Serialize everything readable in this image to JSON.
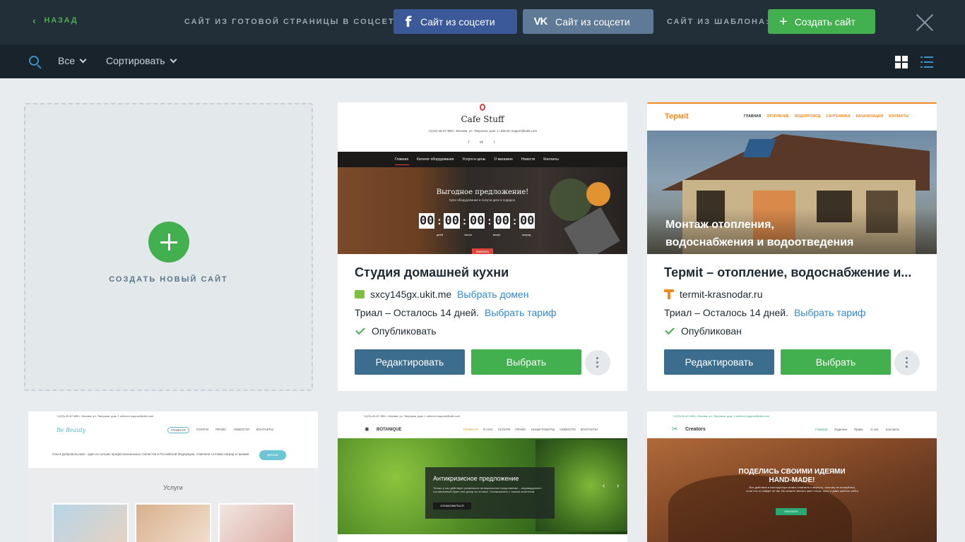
{
  "topbar": {
    "back_label": "НАЗАД",
    "social_label": "САЙТ ИЗ ГОТОВОЙ СТРАНИЦЫ В СОЦСЕТИ:",
    "fb_button": "Сайт из соцсети",
    "vk_button": "Сайт из соцсети",
    "template_label": "САЙТ ИЗ ШАБЛОНА:",
    "create_button": "Создать сайт"
  },
  "filterbar": {
    "filter_all": "Все",
    "sort_label": "Сортировать"
  },
  "new_site": {
    "label": "СОЗДАТЬ НОВЫЙ САЙТ"
  },
  "cards": [
    {
      "title": "Студия домашней кухни",
      "domain": "sxcy145gx.ukit.me",
      "domain_action": "Выбрать домен",
      "trial": "Триал – Осталось 14 дней.",
      "tariff_action": "Выбрать тариф",
      "status": "Опубликовать",
      "edit_button": "Редактировать",
      "select_button": "Выбрать",
      "preview": {
        "brand": "Cafe Stuff",
        "contacts": "+1(23)-45-67-890   г. Москва, ул. Тверская, дом. 1   ukitcom   support@ukit.com",
        "socials": [
          "f",
          "vk",
          "t"
        ],
        "nav": [
          "Главная",
          "Каталог оборудования",
          "Услуги и цены",
          "О магазине",
          "Новости",
          "Контакты"
        ],
        "headline": "Выгодное предложение!",
        "subline": "Купи оборудование и получи диск в подарок.",
        "countdown": [
          "00",
          "00",
          "00",
          "00",
          "00"
        ],
        "countdown_labels": [
          "дней",
          "часов",
          "минут",
          "секунд"
        ],
        "cta": "Заказать"
      }
    },
    {
      "title": "Термit – отопление, водоснабжение и...",
      "domain": "termit-krasnodar.ru",
      "trial": "Триал – Осталось 14 дней.",
      "tariff_action": "Выбрать тариф",
      "status": "Опубликован",
      "edit_button": "Редактировать",
      "select_button": "Выбрать",
      "preview": {
        "brand": "Термit",
        "nav": [
          "ГЛАВНАЯ",
          "ОТОПЛЕНИЕ",
          "ВОДОПРОВОД",
          "САНТЕХНИКА",
          "КАНАЛИЗАЦИЯ",
          "КОНТАКТЫ"
        ],
        "headline_1": "Монтаж отопления,",
        "headline_2": "водоснабжения и водоотведения"
      }
    },
    {
      "preview": {
        "contacts": "+1(23)-45-67-890   г. Москва, ул. Тверская, дом. 1   ukitcom   support@ukit.com",
        "brand": "Be Beauty",
        "nav": [
          "ГЛАВНАЯ",
          "УСЛУГИ",
          "ПРАЙС",
          "НОВОСТИ",
          "КОНТАКТЫ"
        ],
        "intro": "Ольга Добровольская - один из лучших профессиональных стилистов в Российской Федерации, отмечена сотнями наград и премий.",
        "button": "Детали",
        "section_title": "Услуги"
      }
    },
    {
      "preview": {
        "contacts": "+1(23)-45-67-890   г. Москва, ул. Тверская, дом. 1   ukitcom   support@ukit.com",
        "brand": "BOTANIQUE",
        "nav": [
          "ГЛАВНАЯ",
          "О НАС",
          "УСЛУГИ",
          "ПРАЙС",
          "НАШИ РАБОТЫ",
          "НОВОСТИ",
          "КОНТАКТЫ"
        ],
        "headline": "Антикризисное предложение",
        "text": "Только у нас действует уникальное антикризисное предложение – индивидуально составленный букет или декор из готовых. Ознакомьтесь с нашим каталогом.",
        "button": "ОЗНАКОМИТЬСЯ"
      }
    },
    {
      "preview": {
        "contacts": "+1(23)-45-67-890   г. Москва, ул. Тверская, дом. 1   ukitcom   support@ukit.com",
        "brand": "Creators",
        "nav": [
          "Главная",
          "Изделия",
          "Прайс",
          "О нас",
          "Контакты"
        ],
        "headline_1": "ПОДЕЛИСЬ СВОИМИ ИДЕЯМИ",
        "headline_2": "HAND-MADE!",
        "text": "Все действия в конструкторе можно отменить и вернуть, поэтому не волнуйтесь, если что-то пойдет не так. Вы можете менять цвет стиля, текст и даже шаблон сайта.",
        "button": "ЗАКАЗАТЬ"
      }
    }
  ],
  "colors": {
    "topbar_bg": "#222e38",
    "filterbar_bg": "#19232b",
    "page_bg": "#e8ecef",
    "green": "#43b04f",
    "edit_blue": "#3c6d8e",
    "link_blue": "#2f8ad2",
    "facebook": "#3b5998",
    "vk": "#5e7a96"
  }
}
